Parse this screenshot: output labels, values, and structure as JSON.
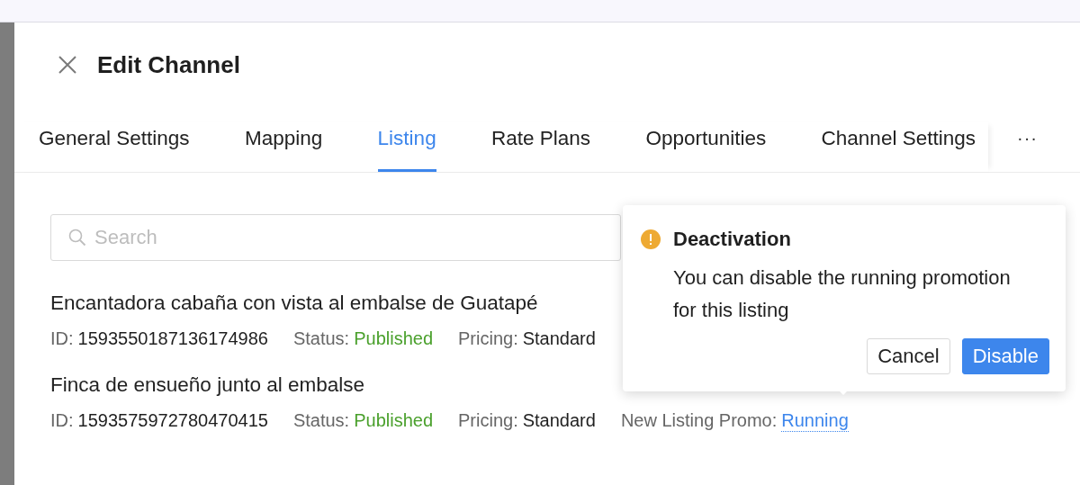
{
  "header": {
    "title": "Edit Channel"
  },
  "tabs": [
    {
      "label": "General Settings",
      "selected": false
    },
    {
      "label": "Mapping",
      "selected": false
    },
    {
      "label": "Listing",
      "selected": true
    },
    {
      "label": "Rate Plans",
      "selected": false
    },
    {
      "label": "Opportunities",
      "selected": false
    },
    {
      "label": "Channel Settings",
      "selected": false
    }
  ],
  "more": "···",
  "search": {
    "placeholder": "Search"
  },
  "listings": [
    {
      "title": "Encantadora cabaña con vista al embalse de Guatapé",
      "fields": [
        {
          "label": "ID:",
          "value": "1593550187136174986",
          "kind": "plain"
        },
        {
          "label": "Status:",
          "value": "Published",
          "kind": "status"
        },
        {
          "label": "Pricing:",
          "value": "Standard",
          "kind": "plain"
        }
      ]
    },
    {
      "title": "Finca de ensueño junto al embalse",
      "fields": [
        {
          "label": "ID:",
          "value": "1593575972780470415",
          "kind": "plain"
        },
        {
          "label": "Status:",
          "value": "Published",
          "kind": "status"
        },
        {
          "label": "Pricing:",
          "value": "Standard",
          "kind": "plain"
        },
        {
          "label": "New Listing Promo:",
          "value": "Running",
          "kind": "link"
        }
      ]
    }
  ],
  "popover": {
    "title": "Deactivation",
    "message": "You can disable the running promotion for this listing",
    "buttons": [
      {
        "label": "Cancel",
        "kind": "default"
      },
      {
        "label": "Disable",
        "kind": "primary"
      }
    ]
  }
}
